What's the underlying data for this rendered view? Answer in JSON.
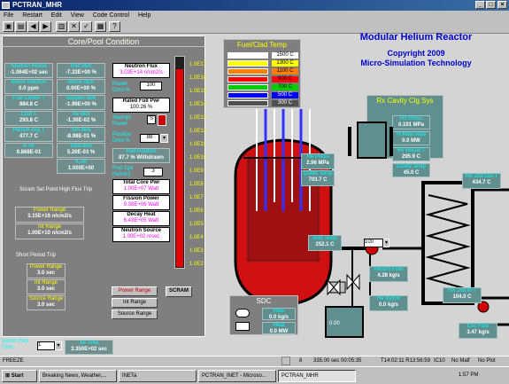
{
  "window": {
    "title": "PCTRAN_MHR"
  },
  "menu": [
    "File",
    "Restart",
    "Edit",
    "View",
    "Code Control",
    "Help"
  ],
  "toolbar_icons": [
    "open-icon",
    "save-icon",
    "back-icon",
    "forward-icon",
    "chart-icon",
    "restart-icon",
    "mode-icon",
    "print-icon",
    "help-icon"
  ],
  "core": {
    "title": "Core/Pool Condition",
    "cells": [
      {
        "label": "Neutron Period",
        "value": "-1.064E+02 sec"
      },
      {
        "label": "Rod dk/k",
        "value": "-7.33E+00 %"
      },
      {
        "label": "Boron Solution",
        "value": "0.0 ppm"
      },
      {
        "label": "Boron dk/k",
        "value": "0.00E+00 %"
      },
      {
        "label": "Fuel Center T",
        "value": "884.8 C"
      },
      {
        "label": "Doppler dk/k",
        "value": "-1.99E+00 %"
      },
      {
        "label": "Clad T",
        "value": "293.8 C"
      },
      {
        "label": "Xe dk/k",
        "value": "-1.30E-02 %"
      },
      {
        "label": "Helium Avg T",
        "value": "477.7 C"
      },
      {
        "label": "Sm dk/k",
        "value": "-8.98E-01 %"
      },
      {
        "label": "K-inf",
        "value": "9.868E-01"
      },
      {
        "label": "Total dk/k",
        "value": "5.20E-03 %"
      },
      {
        "label": "K-eff",
        "value": "1.000E+00"
      }
    ],
    "scram_title": "Scram Set Point High Flux Trip",
    "power_range": {
      "label": "Power Range",
      "value": "3.15E+16 n/cm2/s"
    },
    "int_range": {
      "label": "Int Range",
      "value": "1.00E+10 n/cm2/s"
    },
    "short_period": "Short Period Trip",
    "sp_power": {
      "label": "Power Range",
      "value": "3.0 sec"
    },
    "sp_int": {
      "label": "Int Range",
      "value": "3.0 sec"
    },
    "sp_source": {
      "label": "Source Range",
      "value": "3.0 sec"
    }
  },
  "flux": {
    "neutron_flux": {
      "label": "Neutron Flux",
      "value": "3.03E+14 n/cm2/s"
    },
    "power_demand": {
      "label": "Power Dmd %",
      "value": "100"
    },
    "rated_full": {
      "label": "Rated Full Pwr",
      "value": "100.26 %"
    },
    "startup_power": {
      "label": "Startup/ Power",
      "value": "S"
    },
    "position_demand": {
      "label": "Position Dmd %",
      "value": "88"
    },
    "rod_position": {
      "label": "Rod Position",
      "value": "87.7 % Withdrawn"
    },
    "rod_speed": {
      "label": "Rod Spd (%/min)",
      "value": "3"
    },
    "total_core": {
      "label": "Total Core Pwr",
      "value": "1.00E+07 Watt"
    },
    "fission": {
      "label": "Fission Power",
      "value": "9.38E+06 Watt"
    },
    "decay": {
      "label": "Decay Heat",
      "value": "6.43E+05 Watt"
    },
    "neutron_source": {
      "label": "Neutron Source",
      "value": "1.00E+02 n/sec"
    }
  },
  "scale": [
    "1.0E17",
    "1.0E16",
    "1.0E15",
    "1.0E14",
    "1.0E13",
    "1.0E12",
    "1.0E11",
    "1.0E10",
    "1.0E9",
    "1.0E8",
    "1.0E7",
    "1.0E6",
    "1.0E5",
    "1.0E4",
    "1.0E3",
    "1.0E2"
  ],
  "range_buttons": {
    "power": "Power Range",
    "int": "Int Range",
    "source": "Source Range",
    "scram": "SCRAM"
  },
  "xenon": {
    "label": "Xenon Fast Time",
    "value": "1"
  },
  "xe_time": {
    "label": "Xe Time",
    "value": "3.350E+02 sec"
  },
  "fuel_clad": {
    "title": "Fuel/Clad Temp",
    "levels": [
      {
        "temp": "1500 C",
        "color": "#ffffff"
      },
      {
        "temp": "1300 C",
        "color": "#ffff00"
      },
      {
        "temp": "1100 C",
        "color": "#ff8000"
      },
      {
        "temp": "900 C",
        "color": "#ff0000"
      },
      {
        "temp": "700 C",
        "color": "#00cc00"
      },
      {
        "temp": "500 C",
        "color": "#0000ff"
      },
      {
        "temp": "300 C",
        "color": "#505050"
      }
    ]
  },
  "header": {
    "title": "Modular Helium Reactor",
    "copyright": "Copyright 2009",
    "company": "Micro-Simulation Technology"
  },
  "rx_cavity": {
    "title": "Rx Cavity Clg Sys",
    "hs_press": {
      "label": "HS Press",
      "value": "0.101 MPa"
    },
    "hs_rate": {
      "label": "Hi Rate Rate",
      "value": "0.0 MW"
    },
    "rx_vessel": {
      "label": "Rx Vessel T",
      "value": "295.9 C"
    },
    "cavity": {
      "label": "Cavity Temp",
      "value": "45.0 C"
    }
  },
  "plant": {
    "he_press": {
      "label": "He Press",
      "value": "2.96 MPa"
    },
    "outlet": {
      "label": "Outlet Temp",
      "value": "703.7 C"
    },
    "inlet": {
      "label": "Inlet Temp",
      "value": "252.1 C"
    },
    "valve": "100",
    "he_flow": {
      "label": "Helium Flow",
      "value": "4.28 kg/s"
    },
    "he_inj": {
      "label": "He Inj/Ext",
      "value": "0.0 kg/s"
    },
    "hx_out": {
      "label": "HX 2nd Out T",
      "value": "434.7 C"
    },
    "hx_in": {
      "label": "HX 2nd In T",
      "value": "104.0 C"
    },
    "csc_flow": {
      "label": "Csc Flow",
      "value": "3.47 kg/s"
    },
    "tank": "0.00"
  },
  "sdc": {
    "title": "SDC",
    "flow": {
      "label": "Flow",
      "value": "0.0 kg/s"
    },
    "heat": {
      "label": "Heat",
      "value": "0.0 MW"
    }
  },
  "status": {
    "left": "FREEZE",
    "speed": "8",
    "time": "335.00 sec 00:05:35",
    "clock": "T14:02:11 R13:56:59",
    "ic": "IC10",
    "malf": "No Malf",
    "plot": "No Plot"
  },
  "taskbar": {
    "start": "Start",
    "tasks": [
      "Breaking News, Weather,...",
      "INETa",
      "PCTRAN_INET - Microso...",
      "PCTRAN_MHR"
    ],
    "time": "1:57 PM"
  }
}
